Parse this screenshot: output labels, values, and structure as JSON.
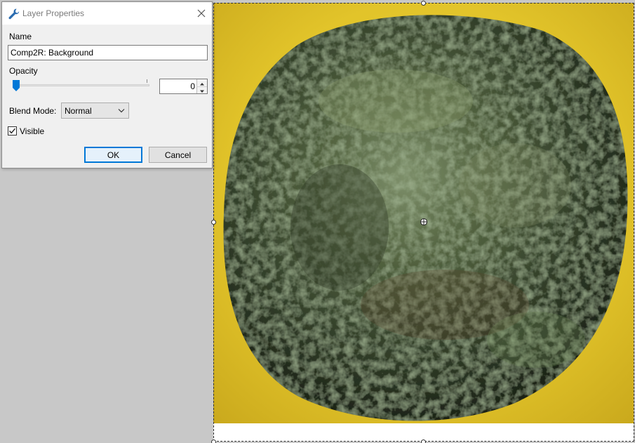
{
  "dialog": {
    "title": "Layer Properties",
    "title_icon": "wrench-icon",
    "close_icon": "close-icon",
    "name_label": "Name",
    "name_value": "Comp2R: Background",
    "opacity_label": "Opacity",
    "opacity_value": "0",
    "blend_mode_label": "Blend Mode:",
    "blend_mode_value": "Normal",
    "visible_label": "Visible",
    "visible_checked": true,
    "ok_label": "OK",
    "cancel_label": "Cancel"
  },
  "colors": {
    "accent": "#0078d7",
    "workspace_bg": "#c8c8c8",
    "dialog_bg": "#f0f0f0",
    "photo_background": "#e0c428",
    "coin": "#3c4a30"
  },
  "canvas": {
    "image": "coin photograph on yellow background"
  }
}
